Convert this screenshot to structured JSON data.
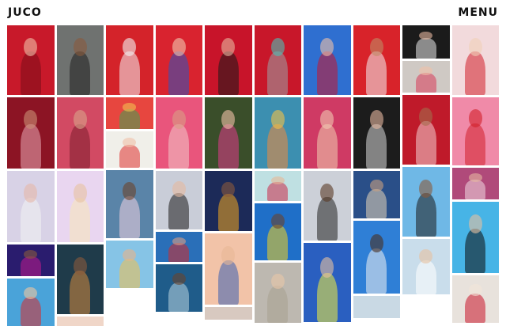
{
  "header": {
    "logo": "JUCO",
    "menu_label": "MENU"
  },
  "gallery": {
    "columns": [
      [
        {
          "h": 88,
          "bg": "#c8192a",
          "fg": "#7a0d18",
          "skin": "#f0c0a8"
        },
        {
          "h": 90,
          "bg": "#8c1424",
          "fg": "#e8a8b4",
          "skin": "#c98f74"
        },
        {
          "h": 90,
          "bg": "#d8d2e6",
          "fg": "#f2f2f2",
          "skin": "#e6b7a8"
        },
        {
          "h": 40,
          "bg": "#2a1c6e",
          "fg": "#c01b8c",
          "skin": "#8b5a3c"
        },
        {
          "h": 60,
          "bg": "#4aa3d9",
          "fg": "#d92c2c",
          "skin": "#f0c6a0"
        }
      ],
      [
        {
          "h": 88,
          "bg": "#6f7270",
          "fg": "#1f1f1f",
          "skin": "#8b5a3c"
        },
        {
          "h": 90,
          "bg": "#d24a63",
          "fg": "#7b1d2e",
          "skin": "#d8a58b"
        },
        {
          "h": 90,
          "bg": "#e9d6f0",
          "fg": "#f7e8b8",
          "skin": "#e8c2a0"
        },
        {
          "h": 88,
          "bg": "#1f3b4a",
          "fg": "#d68a3c",
          "skin": "#8b5a3c"
        },
        {
          "h": 12,
          "bg": "#f0d6c8",
          "fg": "#e0b0a0",
          "skin": "#e0b0a0"
        }
      ],
      [
        {
          "h": 88,
          "bg": "#d4232a",
          "fg": "#f2f2f2",
          "skin": "#f2f2f2"
        },
        {
          "h": 40,
          "bg": "#e7463f",
          "fg": "#3fa552",
          "skin": "#f4c050"
        },
        {
          "h": 46,
          "bg": "#f0efe9",
          "fg": "#e0322f",
          "skin": "#f0c0a8"
        },
        {
          "h": 86,
          "bg": "#5a84a8",
          "fg": "#f0d2e0",
          "skin": "#6b432b"
        },
        {
          "h": 60,
          "bg": "#86c4e6",
          "fg": "#f2c14e",
          "skin": "#e8b48a"
        }
      ],
      [
        {
          "h": 88,
          "bg": "#d9232f",
          "fg": "#2a55c0",
          "skin": "#f0c8b0"
        },
        {
          "h": 90,
          "bg": "#e9557c",
          "fg": "#f2c8c8",
          "skin": "#d99f86"
        },
        {
          "h": 74,
          "bg": "#c9cdd8",
          "fg": "#1c1c1c",
          "skin": "#e6b9a0"
        },
        {
          "h": 38,
          "bg": "#2a6fb8",
          "fg": "#d22a2a",
          "skin": "#d99f86"
        },
        {
          "h": 60,
          "bg": "#1f5c8a",
          "fg": "#b9d6e0",
          "skin": "#6b432b"
        }
      ],
      [
        {
          "h": 88,
          "bg": "#c8142a",
          "fg": "#171717",
          "skin": "#e6b7a0"
        },
        {
          "h": 90,
          "bg": "#3a4e2a",
          "fg": "#e03a8a",
          "skin": "#f0c2a8"
        },
        {
          "h": 76,
          "bg": "#1c2a58",
          "fg": "#f2a51f",
          "skin": "#8b5a3c"
        },
        {
          "h": 90,
          "bg": "#f2c3a8",
          "fg": "#3a5fb0",
          "skin": "#e8b896"
        },
        {
          "h": 16,
          "bg": "#d8c9c0",
          "fg": "#b8a8a0",
          "skin": "#b8a8a0"
        }
      ],
      [
        {
          "h": 88,
          "bg": "#c8172a",
          "fg": "#9aa2a6",
          "skin": "#4bc0b5"
        },
        {
          "h": 90,
          "bg": "#3c8fb0",
          "fg": "#f28a3a",
          "skin": "#f2c24a"
        },
        {
          "h": 38,
          "bg": "#bfe0e2",
          "fg": "#cc2a48",
          "skin": "#e8b896"
        },
        {
          "h": 72,
          "bg": "#1f6fc8",
          "fg": "#f2d21e",
          "skin": "#6b432b"
        },
        {
          "h": 76,
          "bg": "#bdb8b0",
          "fg": "#a8a090",
          "skin": "#e8c6a8"
        }
      ],
      [
        {
          "h": 88,
          "bg": "#2f6fd0",
          "fg": "#c8142a",
          "skin": "#f0c2a8"
        },
        {
          "h": 90,
          "bg": "#cf3a64",
          "fg": "#f0d0b0",
          "skin": "#f0c8b0"
        },
        {
          "h": 88,
          "bg": "#ccd0d8",
          "fg": "#222222",
          "skin": "#5a3a26"
        },
        {
          "h": 100,
          "bg": "#2a5fc0",
          "fg": "#f2ef3a",
          "skin": "#e6c0a0"
        }
      ],
      [
        {
          "h": 88,
          "bg": "#d8232a",
          "fg": "#f2f2f2",
          "skin": "#c08a66"
        },
        {
          "h": 90,
          "bg": "#1c1c1c",
          "fg": "#d8d8d8",
          "skin": "#e6b7a0"
        },
        {
          "h": 60,
          "bg": "#2a4f88",
          "fg": "#e6d6b8",
          "skin": "#c9a080"
        },
        {
          "h": 92,
          "bg": "#2f7fd6",
          "fg": "#f2f2f2",
          "skin": "#4a2e1f"
        },
        {
          "h": 28,
          "bg": "#c9d9e4",
          "fg": "#c8142a",
          "skin": "#f0f0f0"
        }
      ],
      [
        {
          "h": 42,
          "bg": "#1b1b1b",
          "fg": "#e8e8e8",
          "skin": "#e6b7a0"
        },
        {
          "h": 40,
          "bg": "#cfc9c4",
          "fg": "#d83a5a",
          "skin": "#f0c2a8"
        },
        {
          "h": 88,
          "bg": "#bf1a2a",
          "fg": "#f2d0d0",
          "skin": "#a46c4c"
        },
        {
          "h": 88,
          "bg": "#6fb8e6",
          "fg": "#1c1c1c",
          "skin": "#8b5a3c"
        },
        {
          "h": 70,
          "bg": "#c9ddeb",
          "fg": "#ffffff",
          "skin": "#e8c2a0"
        }
      ],
      [
        {
          "h": 88,
          "bg": "#f2dadc",
          "fg": "#d21f2a",
          "skin": "#f0d0b8"
        },
        {
          "h": 86,
          "bg": "#f08aa8",
          "fg": "#d21f2a",
          "skin": "#d21f2a"
        },
        {
          "h": 40,
          "bg": "#b04a7a",
          "fg": "#f0d8e0",
          "skin": "#e6b7a0"
        },
        {
          "h": 90,
          "bg": "#47b4e6",
          "fg": "#0d0d0d",
          "skin": "#e6c0a0"
        },
        {
          "h": 60,
          "bg": "#e8e2dc",
          "fg": "#c8142a",
          "skin": "#f2e6d8"
        }
      ]
    ]
  }
}
